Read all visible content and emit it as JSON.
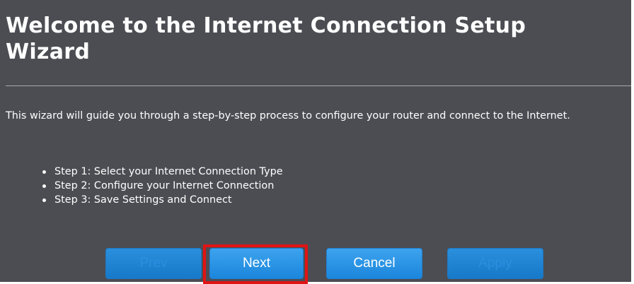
{
  "wizard": {
    "title": "Welcome to the Internet Connection Setup Wizard",
    "intro": "This wizard will guide you through a step-by-step process to configure your router and connect to the Internet.",
    "steps": [
      "Step 1: Select your Internet Connection Type",
      "Step 2: Configure your Internet Connection",
      "Step 3: Save Settings and Connect"
    ]
  },
  "buttons": {
    "prev": {
      "label": "Prev",
      "enabled": false
    },
    "next": {
      "label": "Next",
      "enabled": true,
      "highlighted": true
    },
    "cancel": {
      "label": "Cancel",
      "enabled": true
    },
    "apply": {
      "label": "Apply",
      "enabled": false
    }
  },
  "colors": {
    "panel_background": "#4c4d53",
    "button_blue": "#1b86dc",
    "highlight_red": "#e01414"
  }
}
